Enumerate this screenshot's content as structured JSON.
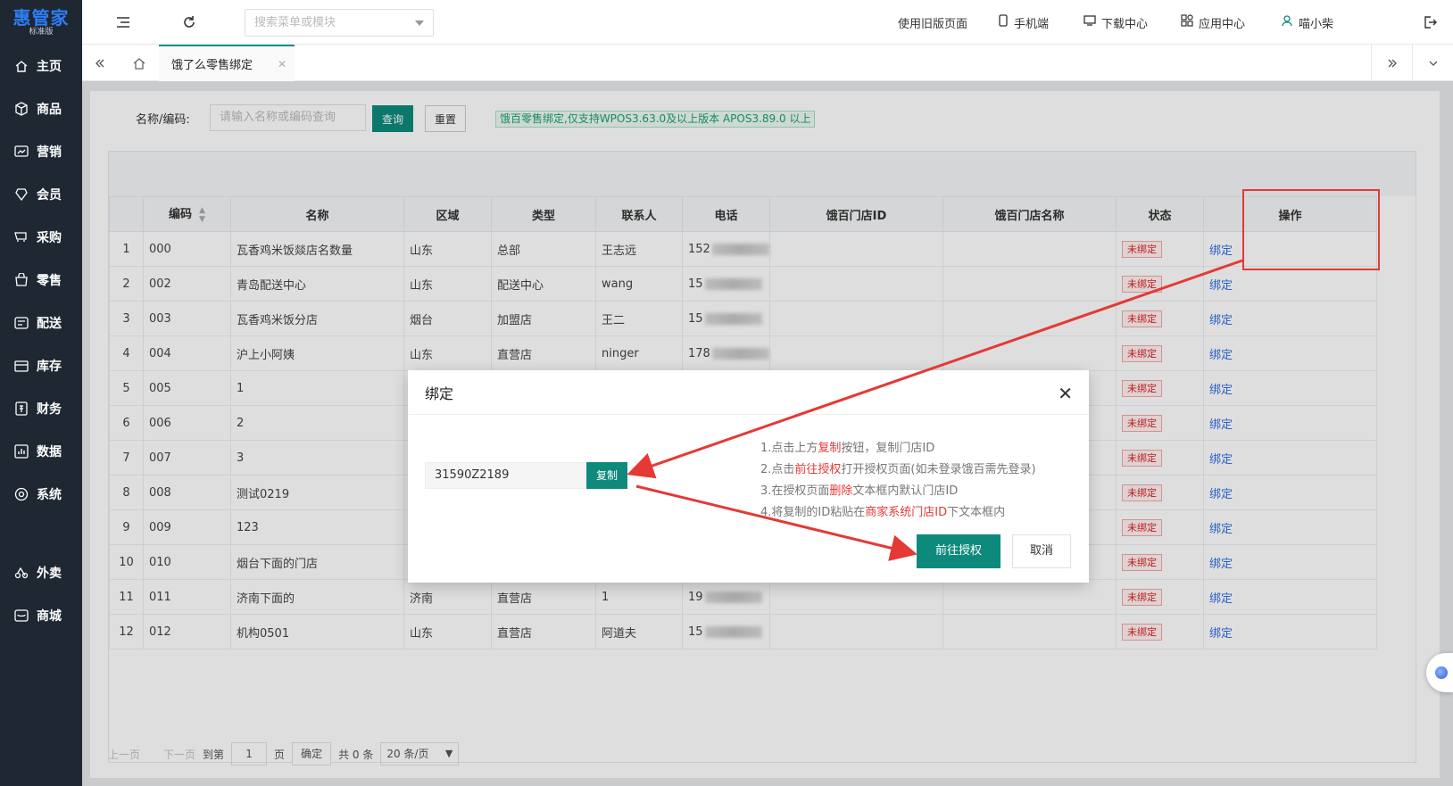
{
  "brand": {
    "name": "惠管家",
    "edition": "标准版"
  },
  "sidebar": {
    "items": [
      {
        "label": "主页",
        "icon": "home-icon"
      },
      {
        "label": "商品",
        "icon": "box-icon"
      },
      {
        "label": "营销",
        "icon": "chart-icon"
      },
      {
        "label": "会员",
        "icon": "heart-icon"
      },
      {
        "label": "采购",
        "icon": "cart-icon"
      },
      {
        "label": "零售",
        "icon": "bag-icon"
      },
      {
        "label": "配送",
        "icon": "truck-icon"
      },
      {
        "label": "库存",
        "icon": "warehouse-icon"
      },
      {
        "label": "财务",
        "icon": "finance-icon"
      },
      {
        "label": "数据",
        "icon": "data-icon"
      },
      {
        "label": "系统",
        "icon": "settings-icon"
      },
      {
        "label": "外卖",
        "icon": "delivery-icon"
      },
      {
        "label": "商城",
        "icon": "store-icon"
      }
    ]
  },
  "topbar": {
    "menu_search_placeholder": "搜索菜单或模块",
    "old_page": "使用旧版页面",
    "mobile": "手机端",
    "download": "下载中心",
    "apps": "应用中心",
    "user": "喵小柴"
  },
  "tabs": {
    "active": "饿了么零售绑定"
  },
  "filter": {
    "label": "名称/编码:",
    "placeholder": "请输入名称或编码查询",
    "query": "查询",
    "reset": "重置",
    "tip": "饿百零售绑定,仅支持WPOS3.63.0及以上版本 APOS3.89.0 以上"
  },
  "table": {
    "headers": [
      "",
      "编码",
      "名称",
      "区域",
      "类型",
      "联系人",
      "电话",
      "饿百门店ID",
      "饿百门店名称",
      "状态",
      "操作"
    ],
    "rows": [
      {
        "idx": "1",
        "code": "000",
        "name": "瓦香鸡米饭燚店名数量",
        "region": "山东",
        "type": "总部",
        "contact": "王志远",
        "phone": "152",
        "status": "未绑定",
        "action": "绑定"
      },
      {
        "idx": "2",
        "code": "002",
        "name": "青岛配送中心",
        "region": "山东",
        "type": "配送中心",
        "contact": "wang",
        "phone": "15",
        "status": "未绑定",
        "action": "绑定"
      },
      {
        "idx": "3",
        "code": "003",
        "name": "瓦香鸡米饭分店",
        "region": "烟台",
        "type": "加盟店",
        "contact": "王二",
        "phone": "15",
        "status": "未绑定",
        "action": "绑定"
      },
      {
        "idx": "4",
        "code": "004",
        "name": "沪上小阿姨",
        "region": "山东",
        "type": "直营店",
        "contact": "ninger",
        "phone": "178",
        "status": "未绑定",
        "action": "绑定"
      },
      {
        "idx": "5",
        "code": "005",
        "name": "1",
        "region": "",
        "type": "",
        "contact": "",
        "phone": "",
        "status": "未绑定",
        "action": "绑定"
      },
      {
        "idx": "6",
        "code": "006",
        "name": "2",
        "region": "",
        "type": "",
        "contact": "",
        "phone": "",
        "status": "未绑定",
        "action": "绑定"
      },
      {
        "idx": "7",
        "code": "007",
        "name": "3",
        "region": "",
        "type": "",
        "contact": "",
        "phone": "",
        "status": "未绑定",
        "action": "绑定"
      },
      {
        "idx": "8",
        "code": "008",
        "name": "测试0219",
        "region": "",
        "type": "",
        "contact": "",
        "phone": "",
        "status": "未绑定",
        "action": "绑定"
      },
      {
        "idx": "9",
        "code": "009",
        "name": "123",
        "region": "",
        "type": "",
        "contact": "",
        "phone": "",
        "status": "未绑定",
        "action": "绑定"
      },
      {
        "idx": "10",
        "code": "010",
        "name": "烟台下面的门店",
        "region": "",
        "type": "",
        "contact": "",
        "phone": "",
        "status": "未绑定",
        "action": "绑定"
      },
      {
        "idx": "11",
        "code": "011",
        "name": "济南下面的",
        "region": "济南",
        "type": "直营店",
        "contact": "1",
        "phone": "19",
        "status": "未绑定",
        "action": "绑定"
      },
      {
        "idx": "12",
        "code": "012",
        "name": "机构0501",
        "region": "山东",
        "type": "直营店",
        "contact": "阿道夫",
        "phone": "15",
        "status": "未绑定",
        "action": "绑定"
      }
    ]
  },
  "pager": {
    "prev": "上一页",
    "next": "下一页",
    "goto": "到第",
    "page_value": "1",
    "page_unit": "页",
    "confirm": "确定",
    "total": "共 0 条",
    "page_size": "20 条/页"
  },
  "modal": {
    "title": "绑定",
    "store_id": "31590Z2189",
    "copy": "复制",
    "steps": [
      {
        "prefix": "1.点击上方",
        "hl": "复制",
        "suffix": "按钮，复制门店ID"
      },
      {
        "prefix": "2.点击",
        "hl": "前往授权",
        "suffix": "打开授权页面(如未登录饿百需先登录)"
      },
      {
        "prefix": "3.在授权页面",
        "hl": "删除",
        "suffix": "文本框内默认门店ID"
      },
      {
        "prefix": "4.将复制的ID粘贴在",
        "hl": "商家系统门店ID",
        "suffix": "下文本框内"
      }
    ],
    "go_auth": "前往授权",
    "cancel": "取消"
  },
  "colors": {
    "primary": "#0d8a7c",
    "sidebar": "#1f2733",
    "link": "#2f6fe4",
    "danger": "#e53935"
  }
}
